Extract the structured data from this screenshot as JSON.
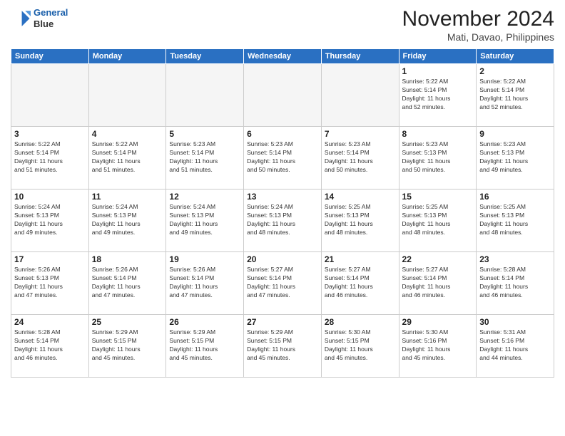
{
  "header": {
    "logo": {
      "line1": "General",
      "line2": "Blue"
    },
    "title": "November 2024",
    "location": "Mati, Davao, Philippines"
  },
  "weekdays": [
    "Sunday",
    "Monday",
    "Tuesday",
    "Wednesday",
    "Thursday",
    "Friday",
    "Saturday"
  ],
  "weeks": [
    [
      {
        "day": "",
        "info": ""
      },
      {
        "day": "",
        "info": ""
      },
      {
        "day": "",
        "info": ""
      },
      {
        "day": "",
        "info": ""
      },
      {
        "day": "",
        "info": ""
      },
      {
        "day": "1",
        "info": "Sunrise: 5:22 AM\nSunset: 5:14 PM\nDaylight: 11 hours\nand 52 minutes."
      },
      {
        "day": "2",
        "info": "Sunrise: 5:22 AM\nSunset: 5:14 PM\nDaylight: 11 hours\nand 52 minutes."
      }
    ],
    [
      {
        "day": "3",
        "info": "Sunrise: 5:22 AM\nSunset: 5:14 PM\nDaylight: 11 hours\nand 51 minutes."
      },
      {
        "day": "4",
        "info": "Sunrise: 5:22 AM\nSunset: 5:14 PM\nDaylight: 11 hours\nand 51 minutes."
      },
      {
        "day": "5",
        "info": "Sunrise: 5:23 AM\nSunset: 5:14 PM\nDaylight: 11 hours\nand 51 minutes."
      },
      {
        "day": "6",
        "info": "Sunrise: 5:23 AM\nSunset: 5:14 PM\nDaylight: 11 hours\nand 50 minutes."
      },
      {
        "day": "7",
        "info": "Sunrise: 5:23 AM\nSunset: 5:14 PM\nDaylight: 11 hours\nand 50 minutes."
      },
      {
        "day": "8",
        "info": "Sunrise: 5:23 AM\nSunset: 5:13 PM\nDaylight: 11 hours\nand 50 minutes."
      },
      {
        "day": "9",
        "info": "Sunrise: 5:23 AM\nSunset: 5:13 PM\nDaylight: 11 hours\nand 49 minutes."
      }
    ],
    [
      {
        "day": "10",
        "info": "Sunrise: 5:24 AM\nSunset: 5:13 PM\nDaylight: 11 hours\nand 49 minutes."
      },
      {
        "day": "11",
        "info": "Sunrise: 5:24 AM\nSunset: 5:13 PM\nDaylight: 11 hours\nand 49 minutes."
      },
      {
        "day": "12",
        "info": "Sunrise: 5:24 AM\nSunset: 5:13 PM\nDaylight: 11 hours\nand 49 minutes."
      },
      {
        "day": "13",
        "info": "Sunrise: 5:24 AM\nSunset: 5:13 PM\nDaylight: 11 hours\nand 48 minutes."
      },
      {
        "day": "14",
        "info": "Sunrise: 5:25 AM\nSunset: 5:13 PM\nDaylight: 11 hours\nand 48 minutes."
      },
      {
        "day": "15",
        "info": "Sunrise: 5:25 AM\nSunset: 5:13 PM\nDaylight: 11 hours\nand 48 minutes."
      },
      {
        "day": "16",
        "info": "Sunrise: 5:25 AM\nSunset: 5:13 PM\nDaylight: 11 hours\nand 48 minutes."
      }
    ],
    [
      {
        "day": "17",
        "info": "Sunrise: 5:26 AM\nSunset: 5:13 PM\nDaylight: 11 hours\nand 47 minutes."
      },
      {
        "day": "18",
        "info": "Sunrise: 5:26 AM\nSunset: 5:14 PM\nDaylight: 11 hours\nand 47 minutes."
      },
      {
        "day": "19",
        "info": "Sunrise: 5:26 AM\nSunset: 5:14 PM\nDaylight: 11 hours\nand 47 minutes."
      },
      {
        "day": "20",
        "info": "Sunrise: 5:27 AM\nSunset: 5:14 PM\nDaylight: 11 hours\nand 47 minutes."
      },
      {
        "day": "21",
        "info": "Sunrise: 5:27 AM\nSunset: 5:14 PM\nDaylight: 11 hours\nand 46 minutes."
      },
      {
        "day": "22",
        "info": "Sunrise: 5:27 AM\nSunset: 5:14 PM\nDaylight: 11 hours\nand 46 minutes."
      },
      {
        "day": "23",
        "info": "Sunrise: 5:28 AM\nSunset: 5:14 PM\nDaylight: 11 hours\nand 46 minutes."
      }
    ],
    [
      {
        "day": "24",
        "info": "Sunrise: 5:28 AM\nSunset: 5:14 PM\nDaylight: 11 hours\nand 46 minutes."
      },
      {
        "day": "25",
        "info": "Sunrise: 5:29 AM\nSunset: 5:15 PM\nDaylight: 11 hours\nand 45 minutes."
      },
      {
        "day": "26",
        "info": "Sunrise: 5:29 AM\nSunset: 5:15 PM\nDaylight: 11 hours\nand 45 minutes."
      },
      {
        "day": "27",
        "info": "Sunrise: 5:29 AM\nSunset: 5:15 PM\nDaylight: 11 hours\nand 45 minutes."
      },
      {
        "day": "28",
        "info": "Sunrise: 5:30 AM\nSunset: 5:15 PM\nDaylight: 11 hours\nand 45 minutes."
      },
      {
        "day": "29",
        "info": "Sunrise: 5:30 AM\nSunset: 5:16 PM\nDaylight: 11 hours\nand 45 minutes."
      },
      {
        "day": "30",
        "info": "Sunrise: 5:31 AM\nSunset: 5:16 PM\nDaylight: 11 hours\nand 44 minutes."
      }
    ]
  ]
}
